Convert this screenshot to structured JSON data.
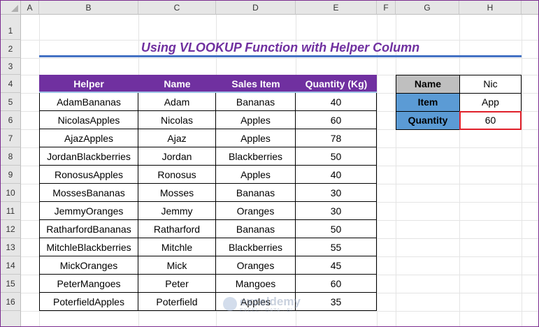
{
  "columns": [
    "A",
    "B",
    "C",
    "D",
    "E",
    "F",
    "G",
    "H"
  ],
  "rows": [
    "1",
    "2",
    "3",
    "4",
    "5",
    "6",
    "7",
    "8",
    "9",
    "10",
    "11",
    "12",
    "13",
    "14",
    "15",
    "16"
  ],
  "title": "Using VLOOKUP Function with Helper Column",
  "table": {
    "headers": [
      "Helper",
      "Name",
      "Sales Item",
      "Quantity (Kg)"
    ],
    "rows": [
      [
        "AdamBananas",
        "Adam",
        "Bananas",
        "40"
      ],
      [
        "NicolasApples",
        "Nicolas",
        "Apples",
        "60"
      ],
      [
        "AjazApples",
        "Ajaz",
        "Apples",
        "78"
      ],
      [
        "JordanBlackberries",
        "Jordan",
        "Blackberries",
        "50"
      ],
      [
        "RonosusApples",
        "Ronosus",
        "Apples",
        "40"
      ],
      [
        "MossesBananas",
        "Mosses",
        "Bananas",
        "30"
      ],
      [
        "JemmyOranges",
        "Jemmy",
        "Oranges",
        "30"
      ],
      [
        "RatharfordBananas",
        "Ratharford",
        "Bananas",
        "50"
      ],
      [
        "MitchleBlackberries",
        "Mitchle",
        "Blackberries",
        "55"
      ],
      [
        "MickOranges",
        "Mick",
        "Oranges",
        "45"
      ],
      [
        "PeterMangoes",
        "Peter",
        "Mangoes",
        "60"
      ],
      [
        "PoterfieldApples",
        "Poterfield",
        "Apples",
        "35"
      ]
    ]
  },
  "lookup": [
    {
      "label": "Name",
      "value": "Nic",
      "label_bg": "#bfbfbf"
    },
    {
      "label": "Item",
      "value": "App",
      "label_bg": "#5b9bd5"
    },
    {
      "label": "Quantity",
      "value": "60",
      "label_bg": "#5b9bd5"
    }
  ],
  "colors": {
    "header_bg": "#7030a0",
    "title": "#7030a0",
    "underline": "#4472c4",
    "selected_border": "#e0202a"
  },
  "watermark": {
    "name": "exceldemy",
    "tagline": "EXCEL · DATA · BI"
  }
}
